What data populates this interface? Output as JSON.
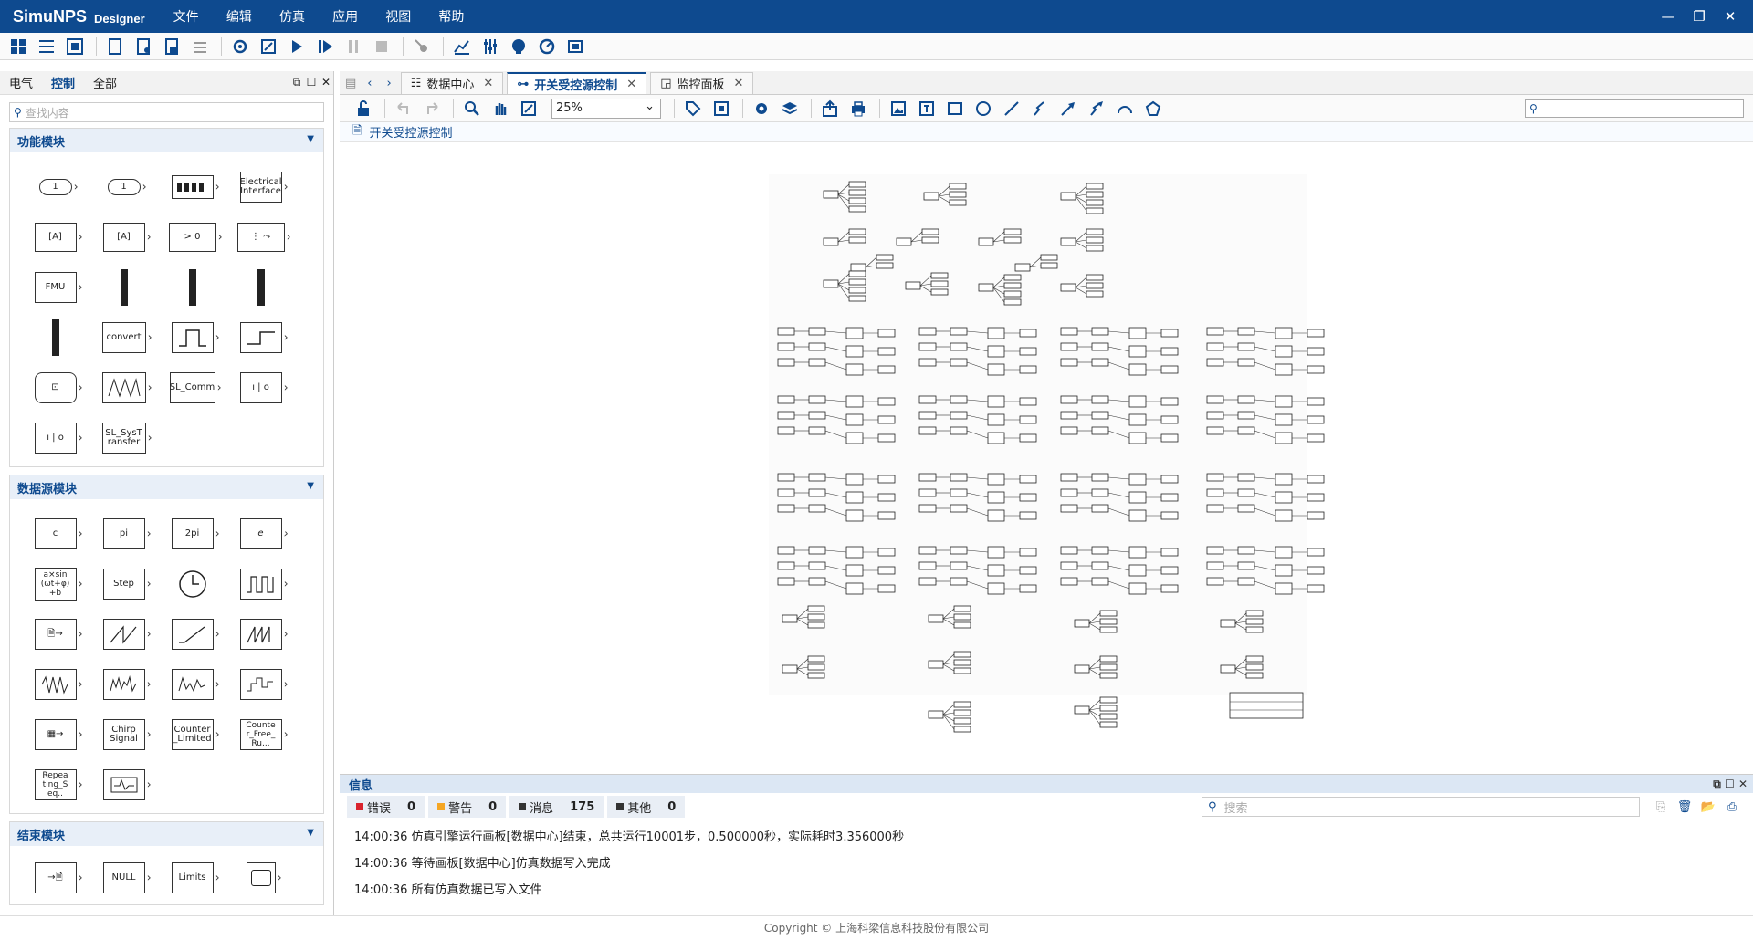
{
  "app": {
    "logo": "SimuNPS",
    "logo_sub": "Designer"
  },
  "menu": [
    "文件",
    "编辑",
    "仿真",
    "应用",
    "视图",
    "帮助"
  ],
  "left": {
    "tabs": [
      "电气",
      "控制",
      "全部"
    ],
    "search_placeholder": "查找内容",
    "sections": [
      {
        "title": "功能模块",
        "blocks": [
          "1",
          "1",
          "",
          "Electrical\nInterface",
          "[A]",
          "[A]",
          "> 0",
          "",
          "FMU",
          "",
          "",
          "",
          "",
          "convert",
          "",
          "",
          "",
          "",
          "SL_Comm",
          "",
          "",
          "SL_SysT\nransfer"
        ]
      },
      {
        "title": "数据源模块",
        "blocks": [
          "c",
          "pi",
          "2pi",
          "e",
          "a×sin\n(ωt+φ)\n+b",
          "Step",
          "",
          "",
          "",
          "",
          "",
          "",
          "",
          "",
          "",
          "",
          "",
          "Chirp\nSignal",
          "Counter\n_Limited",
          "Counte\nr_Free_\nRu...",
          "Repea\nting_S\neq..",
          ""
        ]
      },
      {
        "title": "结束模块",
        "blocks": [
          "",
          "NULL",
          "Limits",
          ""
        ]
      }
    ]
  },
  "tabs": [
    {
      "label": "数据中心",
      "active": false
    },
    {
      "label": "开关受控源控制",
      "active": true
    },
    {
      "label": "监控面板",
      "active": false
    }
  ],
  "toolbar2": {
    "zoom": "25%"
  },
  "breadcrumb": "开关受控源控制",
  "info": {
    "title": "信息",
    "stats": [
      {
        "label": "错误",
        "count": "0",
        "color": "#d9232d"
      },
      {
        "label": "警告",
        "count": "0",
        "color": "#f5a623"
      },
      {
        "label": "消息",
        "count": "175",
        "color": "#333333"
      },
      {
        "label": "其他",
        "count": "0",
        "color": "#333333"
      }
    ],
    "search_placeholder": "搜索",
    "messages": [
      "14:00:36 仿真引擎运行画板[数据中心]结束，总共运行10001步，0.500000秒，实际耗时3.356000秒",
      "14:00:36 等待画板[数据中心]仿真数据写入完成",
      "14:00:36 所有仿真数据已写入文件"
    ]
  },
  "footer": "Copyright © 上海科梁信息科技股份有限公司"
}
